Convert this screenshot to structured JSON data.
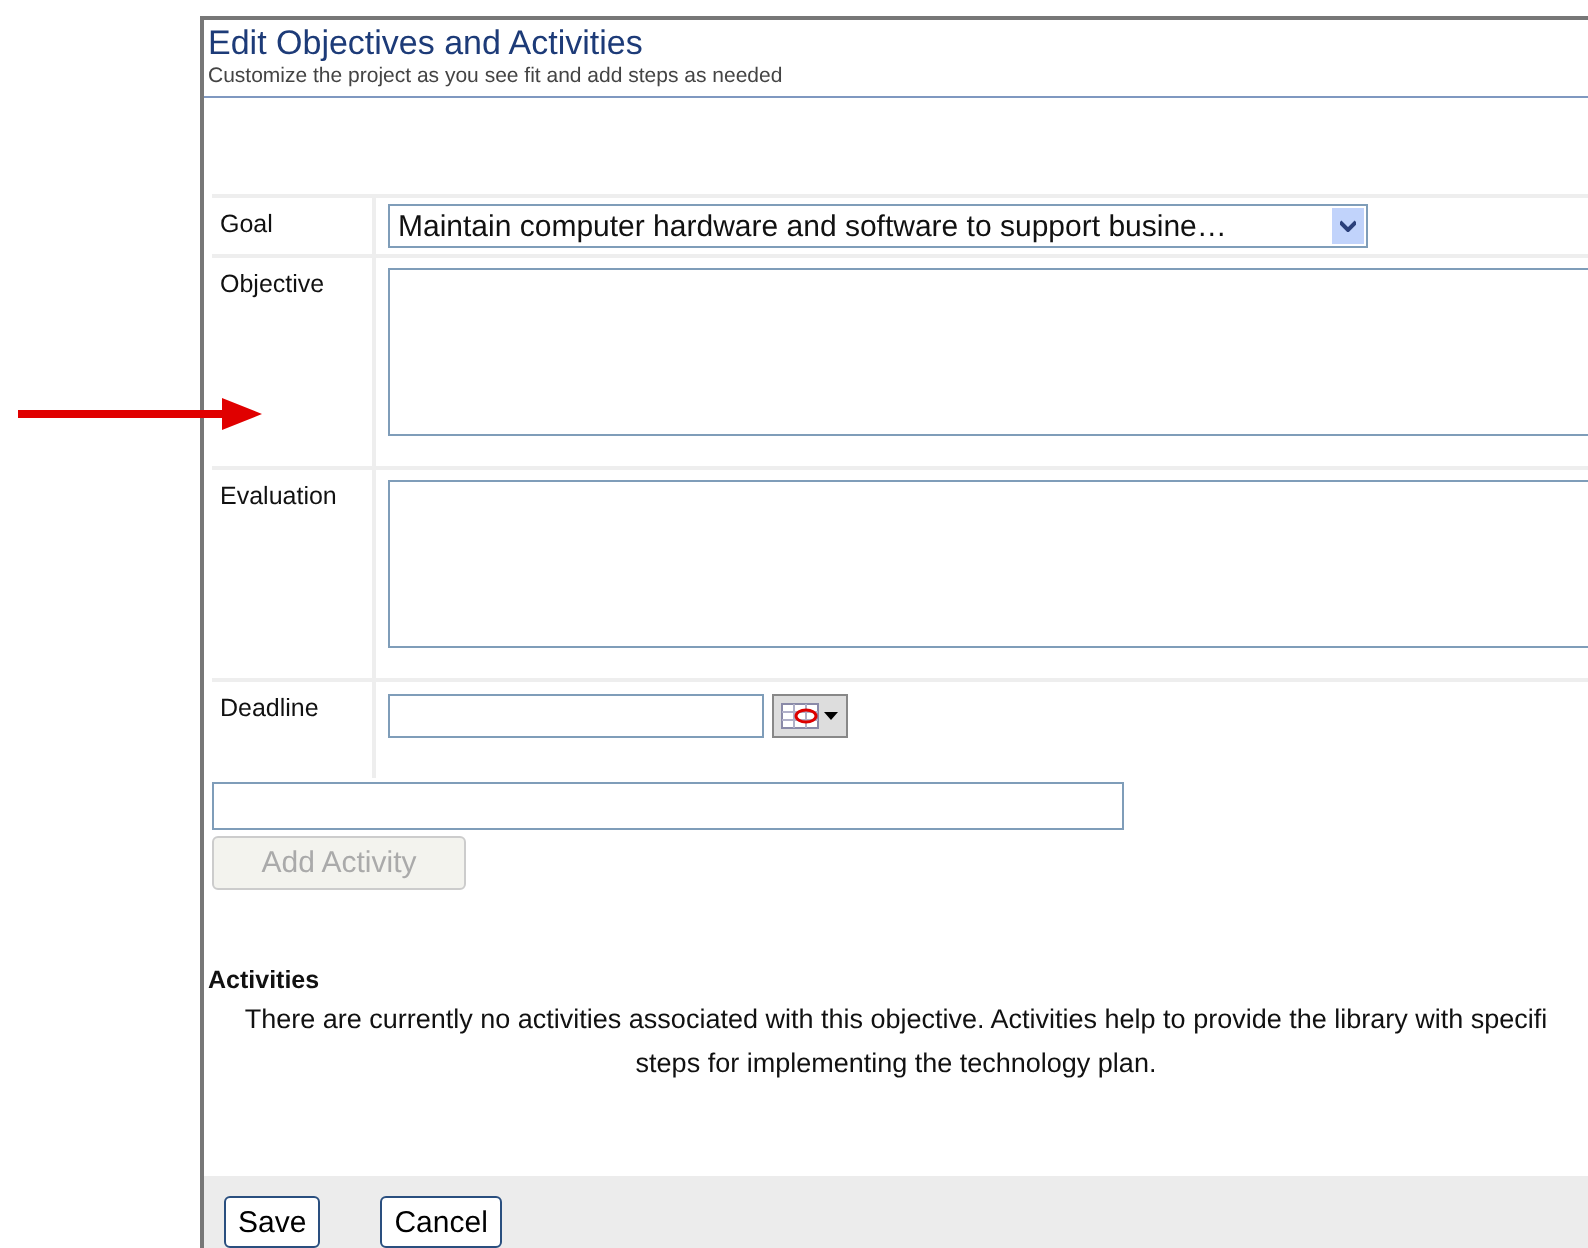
{
  "header": {
    "title": "Edit Objectives and Activities",
    "subtitle": "Customize the project as you see fit and add steps as needed"
  },
  "form": [
    {
      "kind": "select",
      "label": "Goal",
      "value": "Maintain computer hardware and software to support busine…"
    },
    {
      "kind": "textarea",
      "label": "Objective"
    },
    {
      "kind": "textarea",
      "label": "Evaluation"
    },
    {
      "kind": "date",
      "label": "Deadline"
    }
  ],
  "add_activity_button": {
    "label": "Add Activity",
    "disabled": true
  },
  "activities": {
    "heading": "Activities",
    "message_lines": [
      "There are currently no activities associated with this objective. Activities help to provide the library with specifi",
      "steps for implementing the technology plan."
    ]
  },
  "buttons": [
    {
      "label": "Save"
    },
    {
      "label": "Cancel"
    }
  ]
}
